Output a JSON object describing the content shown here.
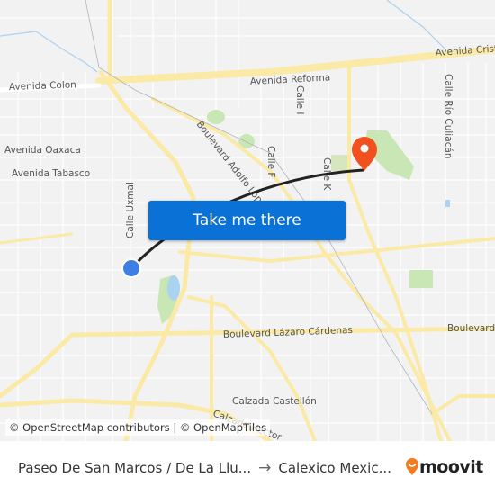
{
  "map": {
    "street_labels": {
      "avenida_colon": "Avenida Colon",
      "avenida_oaxaca": "Avenida Oaxaca",
      "avenida_tabasco": "Avenida Tabasco",
      "avenida_reforma": "Avenida Reforma",
      "avenida_cristobal": "Avenida Crist",
      "calle_i": "Calle I",
      "calle_f": "Calle F",
      "calle_k": "Calle K",
      "calle_rio_culiacan": "Calle Río Culiacán",
      "calle_uxmal": "Calle Uxmal",
      "boulevard_adolfo": "Boulevard Adolfo López",
      "boulevard_lazaro": "Boulevard Lázaro Cárdenas",
      "boulevard_right": "Boulevard",
      "calzada_castellon": "Calzada Castellón",
      "calzada_bottom": "Calzada Héctor"
    },
    "colors": {
      "background": "#f2f2f3",
      "major_road": "#fbe9a6",
      "park": "#c9e6b5",
      "water": "#a9d3f0",
      "route_line": "#222222",
      "origin_marker": "#3d7fe6",
      "destination_marker": "#f0511f"
    }
  },
  "cta_button": {
    "label": "Take me there",
    "color": "#0a72d6"
  },
  "attribution": "© OpenStreetMap contributors | © OpenMapTiles",
  "footer": {
    "origin": "Paseo De San Marcos / De La Llu...",
    "arrow": "→",
    "destination": "Calexico Mexic...",
    "brand": "moovit",
    "brand_color": "#f47b20"
  }
}
